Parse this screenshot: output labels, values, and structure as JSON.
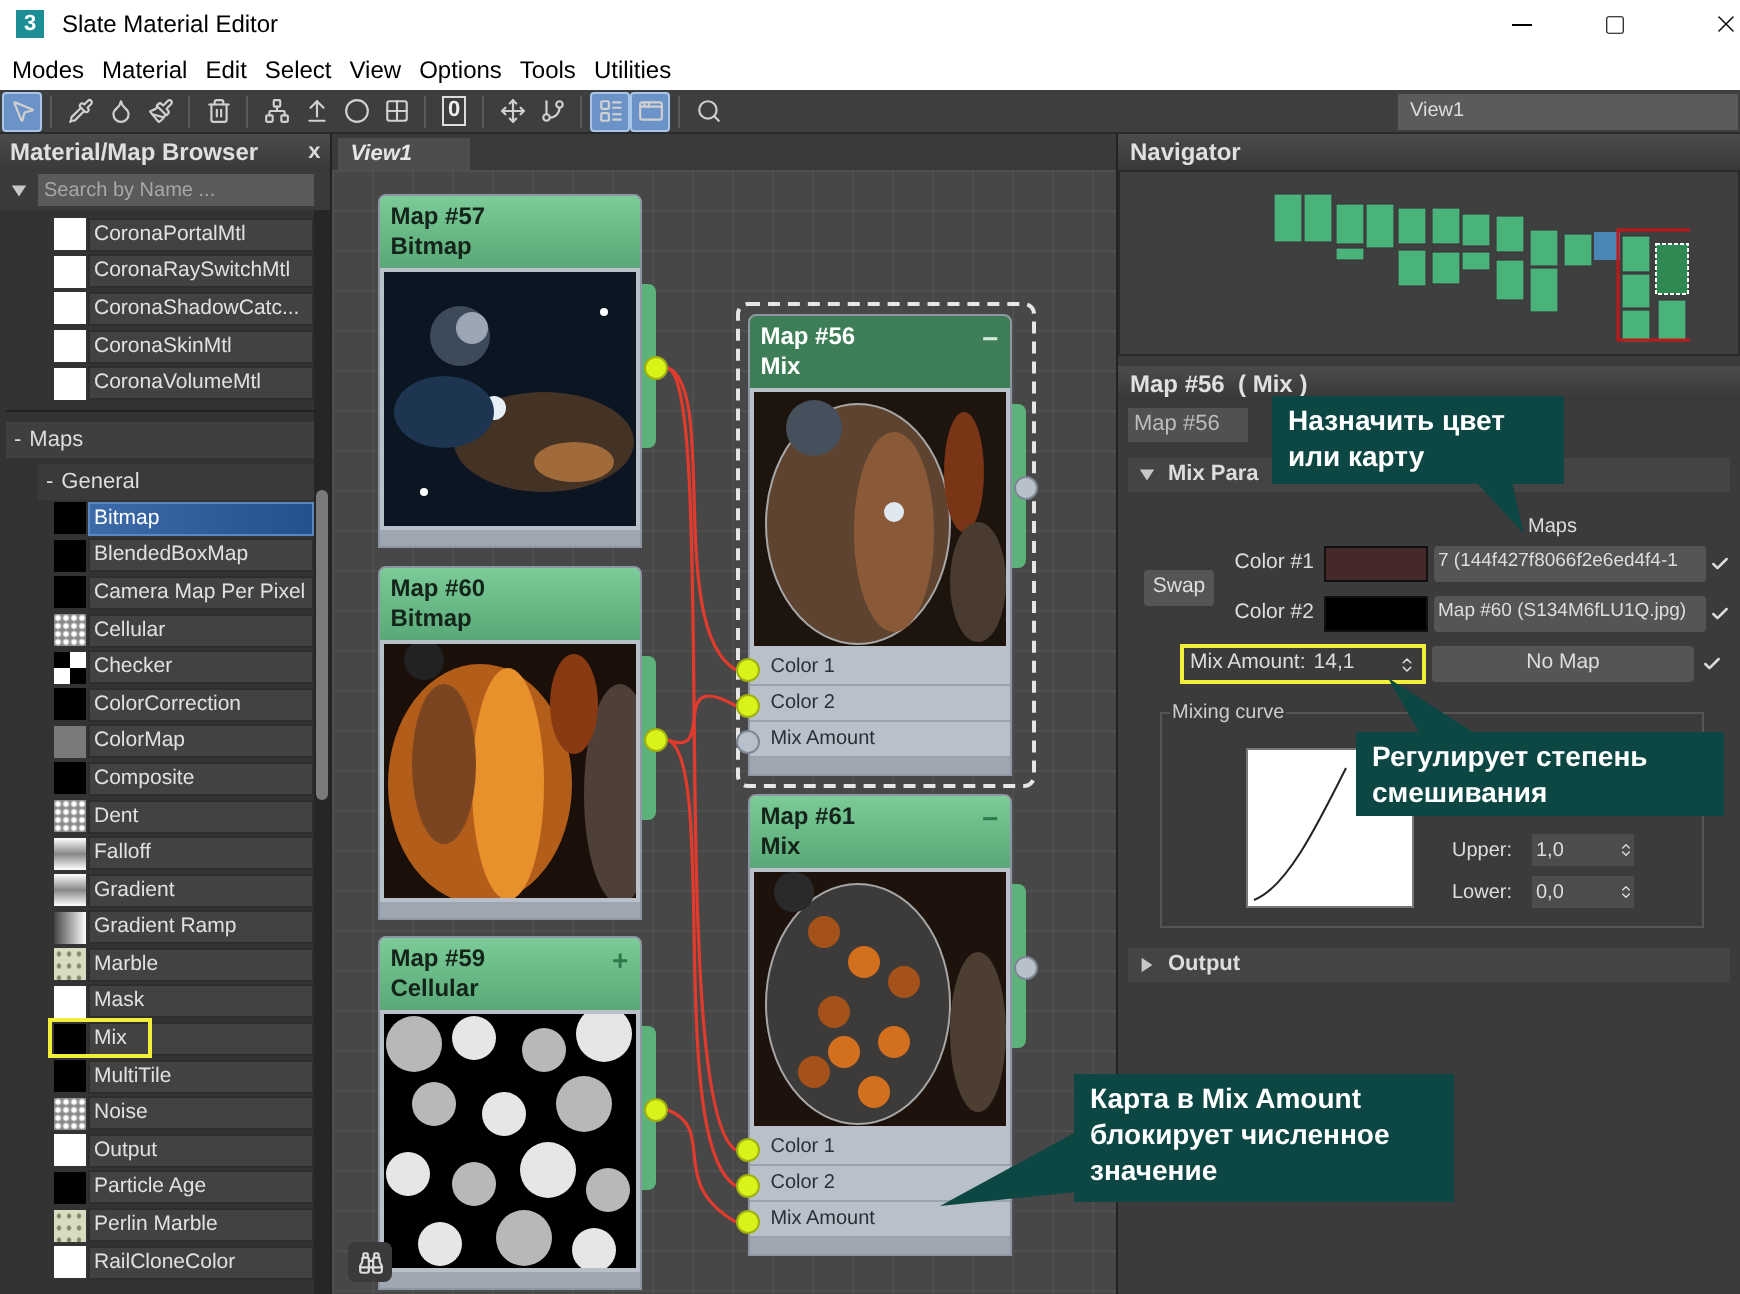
{
  "window": {
    "icon": "3",
    "title": "Slate Material Editor"
  },
  "menu": [
    "Modes",
    "Material",
    "Edit",
    "Select",
    "View",
    "Options",
    "Tools",
    "Utilities"
  ],
  "toolbar": {
    "tools": [
      {
        "selected": true
      },
      {
        "selected": false
      },
      {
        "selected": false
      },
      {
        "selected": false
      },
      {
        "selected": false
      },
      {
        "selected": false
      },
      {
        "selected": false
      },
      {
        "selected": false
      },
      {
        "selected": false
      },
      {
        "selected": false,
        "label": "0"
      },
      {
        "selected": false
      },
      {
        "selected": false
      },
      {
        "selected": true
      },
      {
        "selected": true
      },
      {
        "selected": false
      }
    ],
    "view_selector": "View1"
  },
  "browser": {
    "title": "Material/Map Browser",
    "close": "x",
    "search": {
      "placeholder": "Search by Name ..."
    },
    "materials": [
      {
        "name": "CoronaPortalMtl",
        "kind": "white"
      },
      {
        "name": "CoronaRaySwitchMtl",
        "kind": "white"
      },
      {
        "name": "CoronaShadowCatc...",
        "kind": "white"
      },
      {
        "name": "CoronaSkinMtl",
        "kind": "white"
      },
      {
        "name": "CoronaVolumeMtl",
        "kind": "white"
      }
    ],
    "maps_group": {
      "toggle": "-",
      "label": "Maps"
    },
    "general_group": {
      "toggle": "-",
      "label": "General"
    },
    "maps": [
      {
        "name": "Bitmap",
        "kind": "black",
        "selected": true,
        "highlighted": false
      },
      {
        "name": "BlendedBoxMap",
        "kind": "black",
        "selected": false,
        "highlighted": false
      },
      {
        "name": "Camera Map Per Pixel",
        "kind": "black",
        "selected": false,
        "highlighted": false
      },
      {
        "name": "Cellular",
        "kind": "noise",
        "selected": false,
        "highlighted": false
      },
      {
        "name": "Checker",
        "kind": "checker",
        "selected": false,
        "highlighted": false
      },
      {
        "name": "ColorCorrection",
        "kind": "black",
        "selected": false,
        "highlighted": false
      },
      {
        "name": "ColorMap",
        "kind": "grey",
        "selected": false,
        "highlighted": false
      },
      {
        "name": "Composite",
        "kind": "black",
        "selected": false,
        "highlighted": false
      },
      {
        "name": "Dent",
        "kind": "noise",
        "selected": false,
        "highlighted": false
      },
      {
        "name": "Falloff",
        "kind": "gradient",
        "selected": false,
        "highlighted": false
      },
      {
        "name": "Gradient",
        "kind": "gradient",
        "selected": false,
        "highlighted": false
      },
      {
        "name": "Gradient Ramp",
        "kind": "ramp",
        "selected": false,
        "highlighted": false
      },
      {
        "name": "Marble",
        "kind": "marble",
        "selected": false,
        "highlighted": false
      },
      {
        "name": "Mask",
        "kind": "white",
        "selected": false,
        "highlighted": false
      },
      {
        "name": "Mix",
        "kind": "black",
        "selected": false,
        "highlighted": true
      },
      {
        "name": "MultiTile",
        "kind": "black",
        "selected": false,
        "highlighted": false
      },
      {
        "name": "Noise",
        "kind": "noise",
        "selected": false,
        "highlighted": false
      },
      {
        "name": "Output",
        "kind": "white",
        "selected": false,
        "highlighted": false
      },
      {
        "name": "Particle Age",
        "kind": "black",
        "selected": false,
        "highlighted": false
      },
      {
        "name": "Perlin Marble",
        "kind": "marble",
        "selected": false,
        "highlighted": false
      },
      {
        "name": "RailCloneColor",
        "kind": "white",
        "selected": false,
        "highlighted": false
      }
    ]
  },
  "canvas": {
    "tab": "View1",
    "nodes": [
      {
        "title": "Map #57",
        "type": "Bitmap",
        "selected": false,
        "output_connected": true
      },
      {
        "title": "Map #60",
        "type": "Bitmap",
        "selected": false,
        "output_connected": true
      },
      {
        "title": "Map #59",
        "type": "Cellular",
        "symbol": "+",
        "selected": false,
        "output_connected": true
      },
      {
        "title": "Map #56",
        "type": "Mix",
        "symbol": "−",
        "selected": true,
        "output_connected": false,
        "sockets": [
          {
            "label": "Color 1",
            "connected": true
          },
          {
            "label": "Color 2",
            "connected": true
          },
          {
            "label": "Mix Amount",
            "connected": false
          }
        ]
      },
      {
        "title": "Map #61",
        "type": "Mix",
        "symbol": "−",
        "selected": false,
        "output_connected": false,
        "sockets": [
          {
            "label": "Color 1",
            "connected": true
          },
          {
            "label": "Color 2",
            "connected": true
          },
          {
            "label": "Mix Amount",
            "connected": true
          }
        ]
      }
    ]
  },
  "navigator": {
    "title": "Navigator"
  },
  "params": {
    "title": "Map #56  ( Mix )",
    "name": "Map #56",
    "rollout": {
      "label": "Mix Para",
      "expanded": true
    },
    "maps_label": "Maps",
    "swap": "Swap",
    "colors": [
      {
        "label": "Color #1",
        "color": "#452828",
        "map": "7 (144f427f8066f2e6ed4f4-1",
        "checked": true
      },
      {
        "label": "Color #2",
        "color": "#000000",
        "map": "Map #60 (S134M6fLU1Q.jpg)",
        "checked": true
      }
    ],
    "mix_amount": {
      "label": "Mix Amount:",
      "value": "14,1",
      "map": "No Map",
      "checked": true,
      "highlighted": true
    },
    "curve": {
      "title": "Mixing curve",
      "upper": {
        "label": "Upper:",
        "value": "1,0"
      },
      "lower": {
        "label": "Lower:",
        "value": "0,0"
      }
    },
    "output": {
      "label": "Output",
      "expanded": false
    }
  },
  "callouts": [
    {
      "lines": [
        "Назначить цвет",
        "или карту"
      ]
    },
    {
      "lines": [
        "Регулирует степень",
        "смешивания"
      ]
    },
    {
      "lines": [
        "Карта в Mix Amount",
        "блокирует численное",
        "значение"
      ]
    }
  ]
}
